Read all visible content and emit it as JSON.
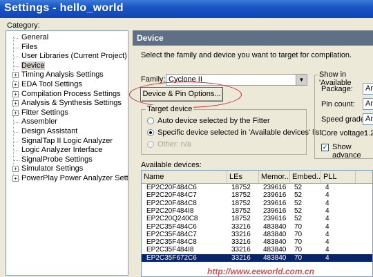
{
  "window": {
    "title": "Settings - hello_world"
  },
  "sidebar": {
    "label": "Category:",
    "items": [
      {
        "label": "General",
        "expandable": false
      },
      {
        "label": "Files",
        "expandable": false
      },
      {
        "label": "User Libraries (Current Project)",
        "expandable": false
      },
      {
        "label": "Device",
        "expandable": false,
        "selected": true
      },
      {
        "label": "Timing Analysis Settings",
        "expandable": true
      },
      {
        "label": "EDA Tool Settings",
        "expandable": true
      },
      {
        "label": "Compilation Process Settings",
        "expandable": true
      },
      {
        "label": "Analysis & Synthesis Settings",
        "expandable": true
      },
      {
        "label": "Fitter Settings",
        "expandable": true
      },
      {
        "label": "Assembler",
        "expandable": false
      },
      {
        "label": "Design Assistant",
        "expandable": false
      },
      {
        "label": "SignalTap II Logic Analyzer",
        "expandable": false
      },
      {
        "label": "Logic Analyzer Interface",
        "expandable": false
      },
      {
        "label": "SignalProbe Settings",
        "expandable": false
      },
      {
        "label": "Simulator Settings",
        "expandable": true
      },
      {
        "label": "PowerPlay Power Analyzer Settings",
        "expandable": true
      }
    ]
  },
  "panel": {
    "title": "Device",
    "description": "Select the family and device you want to target for compilation.",
    "family_label": "Family:",
    "family_value": "Cyclone II",
    "device_pin_button": "Device & Pin Options...",
    "target_device": {
      "title": "Target device",
      "options": [
        {
          "label": "Auto device selected by the Fitter",
          "checked": false,
          "disabled": false
        },
        {
          "label": "Specific device selected in 'Available devices' list",
          "checked": true,
          "disabled": false
        },
        {
          "label": "Other: n/a",
          "checked": false,
          "disabled": true
        }
      ]
    },
    "show_in_available": {
      "title": "Show in 'Available",
      "package_label": "Package:",
      "package_value": "Any",
      "pin_count_label": "Pin count:",
      "pin_count_value": "Any",
      "speed_grade_label": "Speed grade:",
      "speed_grade_value": "Any",
      "core_voltage_label": "Core voltage:",
      "core_voltage_value": "1.2",
      "show_advanced_label": "Show advance",
      "show_advanced_checked": true
    },
    "available_devices_label": "Available devices:",
    "columns": [
      "Name",
      "LEs",
      "Memor...",
      "Embed...",
      "PLL"
    ],
    "rows": [
      {
        "name": "EP2C20F484C6",
        "les": "18752",
        "mem": "239616",
        "embed": "52",
        "pll": "4"
      },
      {
        "name": "EP2C20F484C7",
        "les": "18752",
        "mem": "239616",
        "embed": "52",
        "pll": "4"
      },
      {
        "name": "EP2C20F484C8",
        "les": "18752",
        "mem": "239616",
        "embed": "52",
        "pll": "4"
      },
      {
        "name": "EP2C20F484I8",
        "les": "18752",
        "mem": "239616",
        "embed": "52",
        "pll": "4"
      },
      {
        "name": "EP2C20Q240C8",
        "les": "18752",
        "mem": "239616",
        "embed": "52",
        "pll": "4"
      },
      {
        "name": "EP2C35F484C6",
        "les": "33216",
        "mem": "483840",
        "embed": "70",
        "pll": "4"
      },
      {
        "name": "EP2C35F484C7",
        "les": "33216",
        "mem": "483840",
        "embed": "70",
        "pll": "4"
      },
      {
        "name": "EP2C35F484C8",
        "les": "33216",
        "mem": "483840",
        "embed": "70",
        "pll": "4"
      },
      {
        "name": "EP2C35F484I8",
        "les": "33216",
        "mem": "483840",
        "embed": "70",
        "pll": "4"
      },
      {
        "name": "EP2C35F672C6",
        "les": "33216",
        "mem": "483840",
        "embed": "70",
        "pll": "4",
        "selected": true
      }
    ]
  },
  "watermark": {
    "text": "http://www.eeworld.com.cn"
  },
  "colors": {
    "title_bar": "#1a55c4",
    "panel_header": "#5f6f86",
    "highlight_ellipse": "#d21e2a",
    "selection": "#0a246a"
  }
}
